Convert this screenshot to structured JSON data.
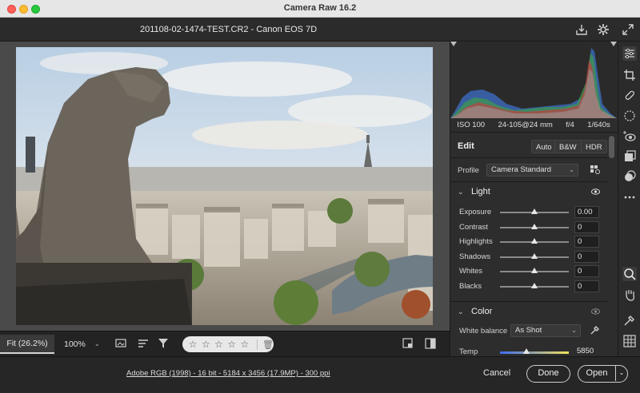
{
  "window": {
    "title": "Camera Raw 16.2"
  },
  "header": {
    "filename": "201108-02-1474-TEST.CR2  -  Canon EOS 7D"
  },
  "viewbar": {
    "fit_label": "Fit (26.2%)",
    "zoom_label": "100%",
    "rating_stars": 0
  },
  "histogram": {
    "iso": "ISO 100",
    "lens": "24-105@24 mm",
    "aperture": "f/4",
    "shutter": "1/640s"
  },
  "edit": {
    "title": "Edit",
    "auto_label": "Auto",
    "bw_label": "B&W",
    "hdr_label": "HDR"
  },
  "profile": {
    "label": "Profile",
    "value": "Camera Standard"
  },
  "light": {
    "title": "Light",
    "sliders": [
      {
        "label": "Exposure",
        "value": "0.00",
        "position": 0.5
      },
      {
        "label": "Contrast",
        "value": "0",
        "position": 0.5
      },
      {
        "label": "Highlights",
        "value": "0",
        "position": 0.5
      },
      {
        "label": "Shadows",
        "value": "0",
        "position": 0.5
      },
      {
        "label": "Whites",
        "value": "0",
        "position": 0.5
      },
      {
        "label": "Blacks",
        "value": "0",
        "position": 0.5
      }
    ]
  },
  "color": {
    "title": "Color",
    "white_balance_label": "White balance",
    "white_balance_value": "As Shot",
    "temp_label": "Temp",
    "temp_value": "5850",
    "temp_position": 0.38
  },
  "footer": {
    "info": "Adobe RGB (1998) - 16 bit - 5184 x 3456 (17.9MP) - 300 ppi",
    "cancel_label": "Cancel",
    "done_label": "Done",
    "open_label": "Open"
  },
  "colors": {
    "panel_bg": "#2d2d2d",
    "canvas_bg": "#4a4a4a",
    "accent_light": "#e6e6e6"
  }
}
